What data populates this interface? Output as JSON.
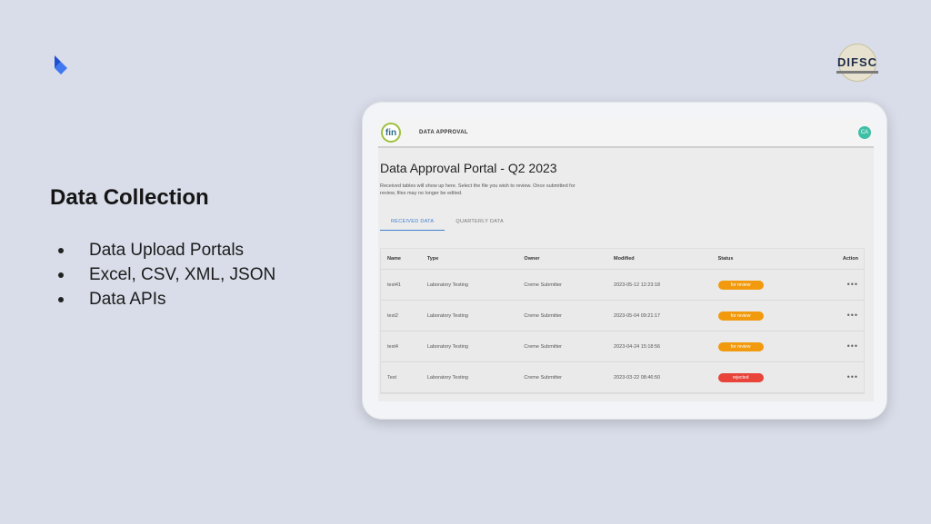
{
  "slide": {
    "title": "Data Collection",
    "bullets": [
      "Data Upload Portals",
      "Excel, CSV, XML, JSON",
      "Data APIs"
    ],
    "brand_color": "#2f5fe0"
  },
  "partner_logo": {
    "text": "DIFSC"
  },
  "app": {
    "logo_text": "fin",
    "nav_label": "DATA APPROVAL",
    "avatar_initials": "CA",
    "portal_title": "Data Approval Portal - Q2 2023",
    "portal_description": "Received tables will show up here. Select the file you wish to review. Once submitted for review, files may no longer be edited.",
    "tabs": [
      {
        "label": "RECEIVED DATA",
        "active": true
      },
      {
        "label": "QUARTERLY DATA",
        "active": false
      }
    ],
    "table": {
      "columns": [
        "Name",
        "Type",
        "Owner",
        "Modified",
        "Status",
        "Action"
      ],
      "rows": [
        {
          "name": "test41",
          "type": "Laboratory Testing",
          "owner": "Creme Submitter",
          "modified": "2023-05-12 12:23:18",
          "status": "for review",
          "status_color": "#f29a0e",
          "action": "•••"
        },
        {
          "name": "test2",
          "type": "Laboratory Testing",
          "owner": "Creme Submitter",
          "modified": "2023-05-04 09:21:17",
          "status": "for review",
          "status_color": "#f29a0e",
          "action": "•••"
        },
        {
          "name": "test4",
          "type": "Laboratory Testing",
          "owner": "Creme Submitter",
          "modified": "2023-04-24 15:18:56",
          "status": "for review",
          "status_color": "#f29a0e",
          "action": "•••"
        },
        {
          "name": "Test",
          "type": "Laboratory Testing",
          "owner": "Creme Submitter",
          "modified": "2023-03-22 08:46:50",
          "status": "rejected",
          "status_color": "#e8443a",
          "action": "•••"
        }
      ]
    }
  }
}
